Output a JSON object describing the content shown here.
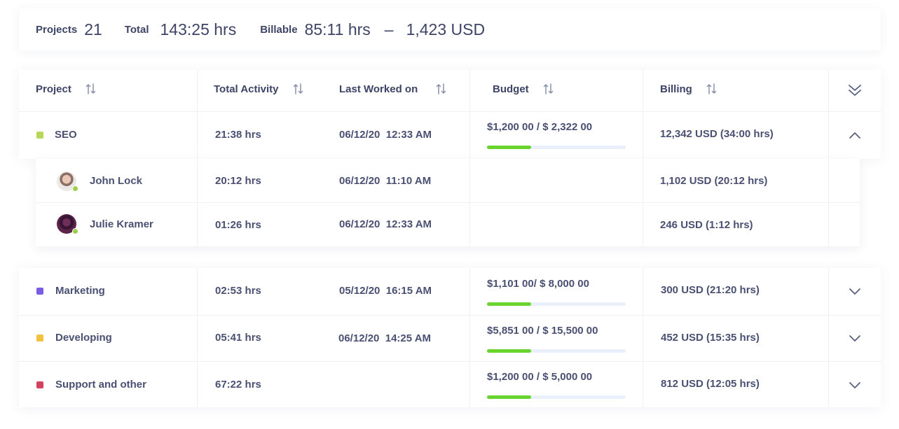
{
  "summary": {
    "projects_label": "Projects",
    "projects_value": "21",
    "total_label": "Total",
    "total_value": "143:25 hrs",
    "billable_label": "Billable",
    "billable_hours": "85:11 hrs",
    "separator": "–",
    "billable_amount": "1,423 USD"
  },
  "table": {
    "headers": {
      "project": "Project",
      "total_activity": "Total Activity",
      "last_worked_on": "Last Worked on",
      "budget": "Budget",
      "billing": "Billing"
    },
    "rows": [
      {
        "name": "SEO",
        "color": "#b9d55a",
        "activity": "21:38 hrs",
        "last_date": "06/12/20",
        "last_time": "12:33 AM",
        "budget": "$1,200 00 / $ 2,322 00",
        "budget_progress": 0.32,
        "billing": "12,342 USD (34:00 hrs)",
        "expanded": true,
        "members": [
          {
            "name": "John Lock",
            "activity": "20:12 hrs",
            "last_date": "06/12/20",
            "last_time": "11:10 AM",
            "billing": "1,102 USD (20:12 hrs)",
            "status_color": "#9ad14b"
          },
          {
            "name": "Julie Kramer",
            "activity": "01:26 hrs",
            "last_date": "06/12/20",
            "last_time": "12:33 AM",
            "billing": "246 USD (1:12 hrs)",
            "status_color": "#9ad14b"
          }
        ]
      },
      {
        "name": "Marketing",
        "color": "#7b5ce6",
        "activity": "02:53 hrs",
        "last_date": "05/12/20",
        "last_time": "16:15 AM",
        "budget": "$1,101 00/ $ 8,000 00",
        "budget_progress": 0.32,
        "billing": "300 USD (21:20 hrs)",
        "expanded": false
      },
      {
        "name": "Developing",
        "color": "#f2c23e",
        "activity": "05:41 hrs",
        "last_date": "06/12/20",
        "last_time": "14:25 AM",
        "budget": "$5,851 00 / $ 15,500 00",
        "budget_progress": 0.32,
        "billing": "452 USD (15:35 hrs)",
        "expanded": false
      },
      {
        "name": "Support and other",
        "color": "#d2415e",
        "activity": "67:22 hrs",
        "last_date": "",
        "last_time": "",
        "budget": "$1,200 00 / $ 5,000 00",
        "budget_progress": 0.32,
        "billing": "812 USD (12:05 hrs)",
        "expanded": false
      }
    ]
  },
  "icons": {
    "sort": "sort-arrows-icon",
    "collapse_all": "double-chevron-down-icon",
    "expand": "chevron-down-icon",
    "collapse": "chevron-up-icon",
    "avatar": "avatar"
  }
}
